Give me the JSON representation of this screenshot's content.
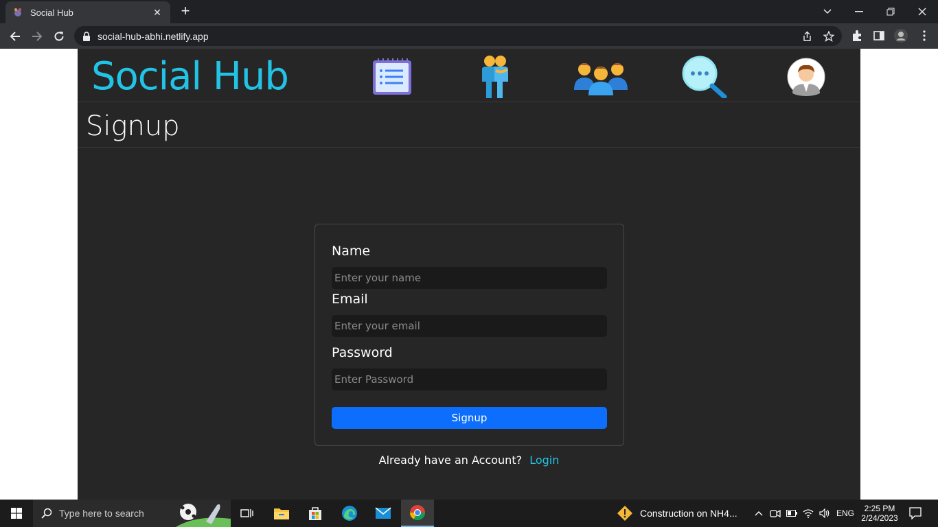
{
  "browser": {
    "tab_title": "Social Hub",
    "new_tab_symbol": "+",
    "close_symbol": "✕",
    "url": "social-hub-abhi.netlify.app"
  },
  "app": {
    "brand": "Social Hub",
    "nav_icons": [
      "notepad-icon",
      "friends-icon",
      "group-icon",
      "search-chat-icon",
      "profile-avatar-icon"
    ],
    "page_title": "Signup",
    "form": {
      "name_label": "Name",
      "name_placeholder": "Enter your name",
      "email_label": "Email",
      "email_placeholder": "Enter your email",
      "password_label": "Password",
      "password_placeholder": "Enter Password",
      "submit_label": "Signup"
    },
    "footer_text": "Already have an Account?",
    "login_link": "Login"
  },
  "taskbar": {
    "search_placeholder": "Type here to search",
    "notification": "Construction on NH4...",
    "language": "ENG",
    "time": "2:25 PM",
    "date": "2/24/2023"
  },
  "colors": {
    "brand": "#22c4e6",
    "page_bg": "#262626",
    "button": "#0d6efd"
  }
}
